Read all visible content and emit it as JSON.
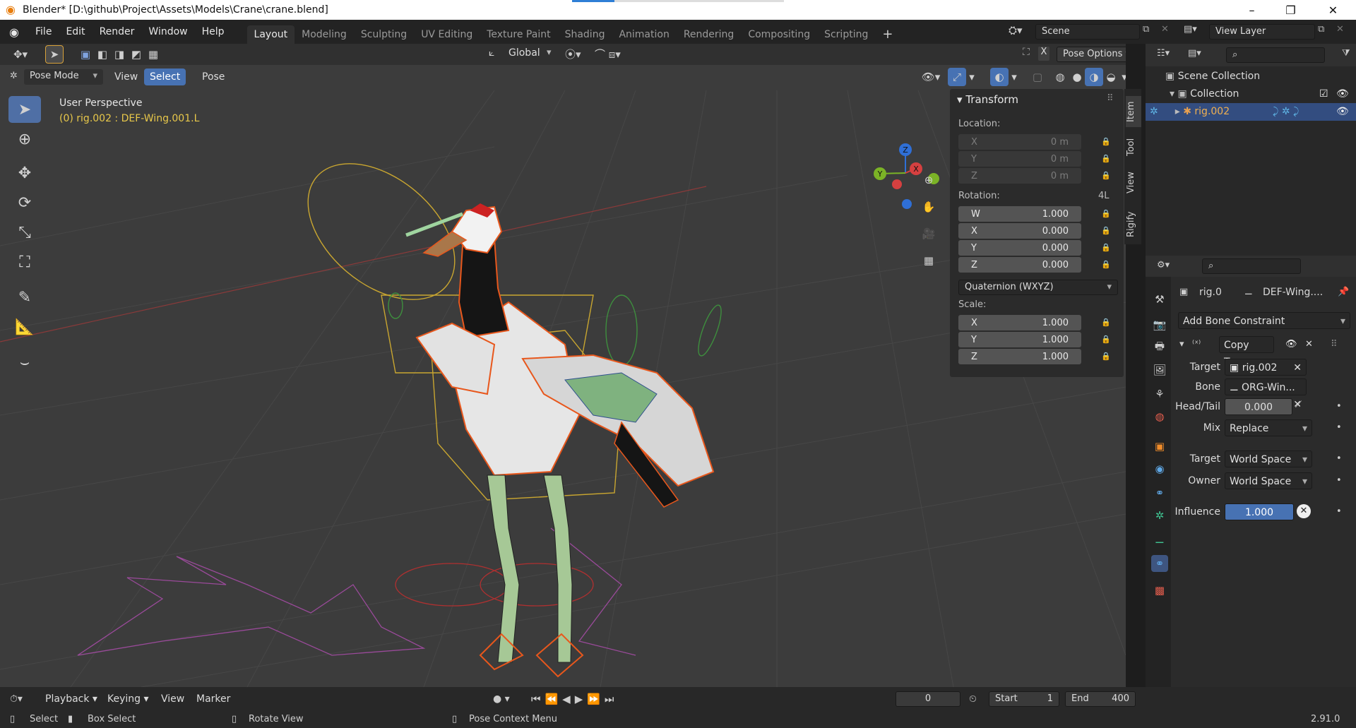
{
  "window": {
    "title": "Blender* [D:\\github\\Project\\Assets\\Models\\Crane\\crane.blend]",
    "minimize": "–",
    "restore": "❐",
    "close": "✕"
  },
  "menu": [
    "File",
    "Edit",
    "Render",
    "Window",
    "Help"
  ],
  "workspaces": [
    "Layout",
    "Modeling",
    "Sculpting",
    "UV Editing",
    "Texture Paint",
    "Shading",
    "Animation",
    "Rendering",
    "Compositing",
    "Scripting"
  ],
  "active_workspace": "Layout",
  "add_workspace": "+",
  "scene": {
    "label": "Scene"
  },
  "view_layer": {
    "label": "View Layer"
  },
  "viewport_header": {
    "orientation": "Global",
    "pose_options": "Pose Options",
    "mode": "Pose Mode",
    "view": "View",
    "select": "Select",
    "pose": "Pose",
    "x_label": "X"
  },
  "viewport": {
    "perspective": "User Perspective",
    "active": "(0) rig.002 : DEF-Wing.001.L",
    "gizmo": {
      "z": "Z",
      "y": "Y",
      "x": "X"
    }
  },
  "n_panel": {
    "title": "Transform",
    "location_label": "Location:",
    "location": [
      {
        "axis": "X",
        "value": "0 m"
      },
      {
        "axis": "Y",
        "value": "0 m"
      },
      {
        "axis": "Z",
        "value": "0 m"
      }
    ],
    "rotation_label": "Rotation:",
    "rotation_lock": "4L",
    "rotation": [
      {
        "axis": "W",
        "value": "1.000"
      },
      {
        "axis": "X",
        "value": "0.000"
      },
      {
        "axis": "Y",
        "value": "0.000"
      },
      {
        "axis": "Z",
        "value": "0.000"
      }
    ],
    "rotation_mode": "Quaternion (WXYZ)",
    "scale_label": "Scale:",
    "scale": [
      {
        "axis": "X",
        "value": "1.000"
      },
      {
        "axis": "Y",
        "value": "1.000"
      },
      {
        "axis": "Z",
        "value": "1.000"
      }
    ],
    "tabs": [
      "Item",
      "Tool",
      "View",
      "Rigify"
    ]
  },
  "outliner": {
    "scene_collection": "Scene Collection",
    "collection": "Collection",
    "rig": "rig.002"
  },
  "properties": {
    "object": "rig.0",
    "bone": "DEF-Wing....",
    "add_constraint": "Add Bone Constraint",
    "constraint_name": "Copy Tra...",
    "target_label": "Target",
    "target": "rig.002",
    "bone_label": "Bone",
    "bone_value": "ORG-Win...",
    "headtail_label": "Head/Tail",
    "headtail": "0.000",
    "mix_label": "Mix",
    "mix": "Replace",
    "target_space_label": "Target",
    "target_space": "World Space",
    "owner_space_label": "Owner",
    "owner_space": "World Space",
    "influence_label": "Influence",
    "influence": "1.000"
  },
  "timeline": {
    "playback": "Playback",
    "keying": "Keying",
    "view": "View",
    "marker": "Marker",
    "frame": "0",
    "start_label": "Start",
    "start": "1",
    "end_label": "End",
    "end": "400"
  },
  "status": {
    "select": "Select",
    "box_select": "Box Select",
    "rotate_view": "Rotate View",
    "pose_menu": "Pose Context Menu",
    "version": "2.91.0"
  },
  "colors": {
    "accent": "#4772b3",
    "active_tool": "#4f6fa5",
    "viewport_bg": "#3c3c3c",
    "selection_orange": "#e8571c"
  }
}
